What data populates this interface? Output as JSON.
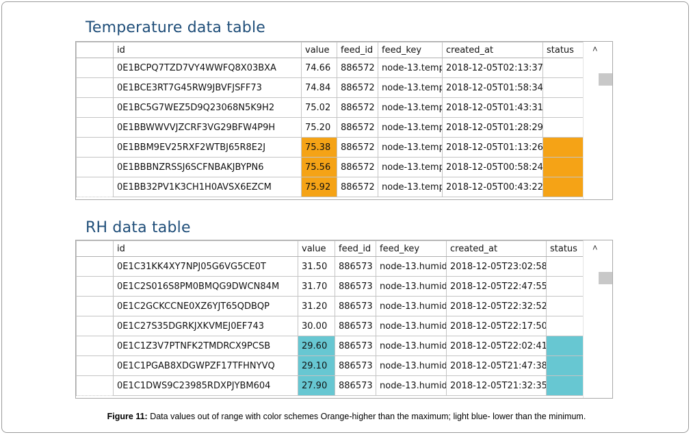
{
  "temperature_table": {
    "title": "Temperature data table",
    "columns": [
      "id",
      "value",
      "feed_id",
      "feed_key",
      "created_at",
      "status"
    ],
    "rows": [
      {
        "id": "0E1BCPQ7TZD7VY4WWFQ8X03BXA",
        "value": "74.66",
        "feed_id": "886572",
        "feed_key": "node-13.temp",
        "created_at": "2018-12-05T02:13:37",
        "status": "",
        "flag": "normal"
      },
      {
        "id": "0E1BCE3RT7G45RW9JBVFJSFF73",
        "value": "74.84",
        "feed_id": "886572",
        "feed_key": "node-13.temp",
        "created_at": "2018-12-05T01:58:34",
        "status": "",
        "flag": "normal"
      },
      {
        "id": "0E1BC5G7WEZ5D9Q23068N5K9H2",
        "value": "75.02",
        "feed_id": "886572",
        "feed_key": "node-13.temp",
        "created_at": "2018-12-05T01:43:31",
        "status": "",
        "flag": "normal"
      },
      {
        "id": "0E1BBWWVVJZCRF3VG29BFW4P9H",
        "value": "75.20",
        "feed_id": "886572",
        "feed_key": "node-13.temp",
        "created_at": "2018-12-05T01:28:29",
        "status": "",
        "flag": "normal"
      },
      {
        "id": "0E1BBM9EV25RXF2WTBJ65R8E2J",
        "value": "75.38",
        "feed_id": "886572",
        "feed_key": "node-13.temp",
        "created_at": "2018-12-05T01:13:26",
        "status": "",
        "flag": "high"
      },
      {
        "id": "0E1BBBNZRSSJ6SCFNBAKJBYPN6",
        "value": "75.56",
        "feed_id": "886572",
        "feed_key": "node-13.temp",
        "created_at": "2018-12-05T00:58:24",
        "status": "",
        "flag": "high"
      },
      {
        "id": "0E1BB32PV1K3CH1H0AVSX6EZCM",
        "value": "75.92",
        "feed_id": "886572",
        "feed_key": "node-13.temp",
        "created_at": "2018-12-05T00:43:22",
        "status": "",
        "flag": "high"
      }
    ]
  },
  "rh_table": {
    "title": "RH data table",
    "columns": [
      "id",
      "value",
      "feed_id",
      "feed_key",
      "created_at",
      "status"
    ],
    "rows": [
      {
        "id": "0E1C31KK4XY7NPJ05G6VG5CE0T",
        "value": "31.50",
        "feed_id": "886573",
        "feed_key": "node-13.humid",
        "created_at": "2018-12-05T23:02:58",
        "status": "",
        "flag": "normal"
      },
      {
        "id": "0E1C2S016S8PM0BMQG9DWCN84M",
        "value": "31.70",
        "feed_id": "886573",
        "feed_key": "node-13.humid",
        "created_at": "2018-12-05T22:47:55",
        "status": "",
        "flag": "normal"
      },
      {
        "id": "0E1C2GCKCCNE0XZ6YJT65QDBQP",
        "value": "31.20",
        "feed_id": "886573",
        "feed_key": "node-13.humid",
        "created_at": "2018-12-05T22:32:52",
        "status": "",
        "flag": "normal"
      },
      {
        "id": "0E1C27S35DGRKJXKVMEJ0EF743",
        "value": "30.00",
        "feed_id": "886573",
        "feed_key": "node-13.humid",
        "created_at": "2018-12-05T22:17:50",
        "status": "",
        "flag": "normal"
      },
      {
        "id": "0E1C1Z3V7PTNFK2TMDRCX9PCSB",
        "value": "29.60",
        "feed_id": "886573",
        "feed_key": "node-13.humid",
        "created_at": "2018-12-05T22:02:41",
        "status": "",
        "flag": "low"
      },
      {
        "id": "0E1C1PGAB8XDGWPZF17TFHNYVQ",
        "value": "29.10",
        "feed_id": "886573",
        "feed_key": "node-13.humid",
        "created_at": "2018-12-05T21:47:38",
        "status": "",
        "flag": "low"
      },
      {
        "id": "0E1C1DWS9C23985RDXPJYBM604",
        "value": "27.90",
        "feed_id": "886573",
        "feed_key": "node-13.humid",
        "created_at": "2018-12-05T21:32:35",
        "status": "",
        "flag": "low"
      }
    ]
  },
  "colors": {
    "higher_than_maximum": "#f5a316",
    "lower_than_minimum": "#67c7d2",
    "title": "#1f4e79"
  },
  "icons": {
    "scroll_up": "chevron-up-icon"
  },
  "caption": {
    "label": "Figure 11:",
    "text": " Data values out of range with color schemes Orange-higher than the maximum; light blue- lower than the minimum."
  }
}
